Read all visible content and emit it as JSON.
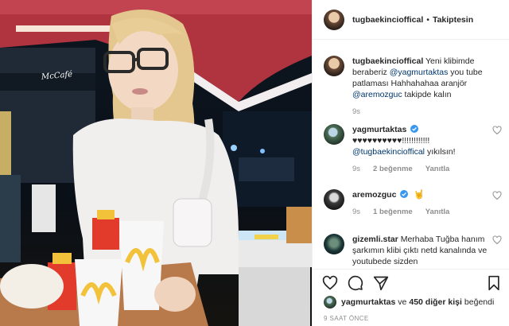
{
  "post": {
    "author": "tugbaekincioffical",
    "following_label": "Takiptesin",
    "separator": "•"
  },
  "photo": {
    "sign_text": "McCafé",
    "description_icon": "photo-woman-with-fastfood-tray"
  },
  "comments": [
    {
      "user": "tugbaekincioffical",
      "text_parts": [
        "Yeni klibimde beraberiz ",
        "@yagmurtaktas",
        " you tube patlaması Hahhahahaa aranjör ",
        "@aremozguc",
        " takipde kalın"
      ],
      "time": "9s",
      "likes": "",
      "reply": ""
    },
    {
      "user": "yagmurtaktas",
      "verified": true,
      "text_line1": "♥♥♥♥♥♥♥♥♥♥!!!!!!!!!!!!",
      "mention": "@tugbaekincioffical",
      "text_after": " yıkılsın!",
      "time": "9s",
      "likes": "2 beğenme",
      "reply": "Yanıtla"
    },
    {
      "user": "aremozguc",
      "verified": true,
      "emoji": "🤘",
      "time": "9s",
      "likes": "1 beğenme",
      "reply": "Yanıtla"
    },
    {
      "user": "gizemli.star",
      "text": "Merhaba Tuğba hanım şarkımın klibi çıktı netd kanalında ve youtubede sizden"
    }
  ],
  "footer": {
    "likes_user": "yagmurtaktas",
    "likes_and": "ve",
    "likes_count": "450 diğer kişi",
    "likes_suffix": "beğendi",
    "time": "9 SAAT ÖNCE"
  },
  "icons": {
    "like": "heart-icon",
    "comment": "comment-icon",
    "share": "share-icon",
    "save": "bookmark-icon"
  },
  "colors": {
    "mention": "#00376b",
    "verified": "#3897f0",
    "muted": "#8e8e8e",
    "text": "#262626"
  }
}
